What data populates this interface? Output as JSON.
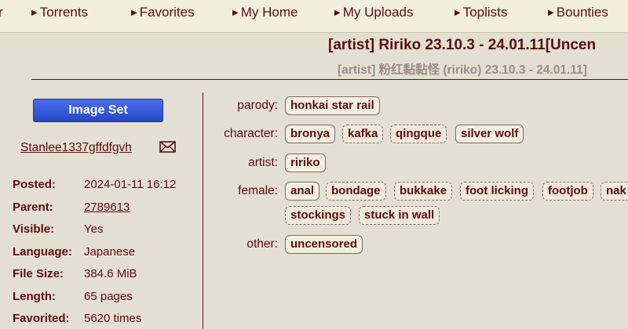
{
  "nav": {
    "edge": "r",
    "items": [
      "Torrents",
      "Favorites",
      "My Home",
      "My Uploads",
      "Toplists",
      "Bounties"
    ]
  },
  "gallery": {
    "title_en": "[artist] Ririko 23.10.3 - 24.01.11[Uncen",
    "title_jp": "[artist] 粉红黏黏怪 (ririko) 23.10.3 - 24.01.11]",
    "category": "Image Set",
    "category_color": "#2f54c9",
    "uploader": "Stanlee1337gffdfgvh",
    "info": [
      {
        "label": "Posted:",
        "value": "2024-01-11 16:12"
      },
      {
        "label": "Parent:",
        "value": "2789613"
      },
      {
        "label": "Visible:",
        "value": "Yes"
      },
      {
        "label": "Language:",
        "value": "Japanese"
      },
      {
        "label": "File Size:",
        "value": "384.6 MiB"
      },
      {
        "label": "Length:",
        "value": "65 pages"
      },
      {
        "label": "Favorited:",
        "value": "5620 times"
      }
    ]
  },
  "tags": {
    "parody_label": "parody:",
    "character_label": "character:",
    "artist_label": "artist:",
    "female_label": "female:",
    "other_label": "other:",
    "parody": [
      "honkai star rail"
    ],
    "character": [
      "bronya",
      "kafka",
      "qingque",
      "silver wolf"
    ],
    "artist": [
      "ririko"
    ],
    "female": [
      "anal",
      "bondage",
      "bukkake",
      "foot licking",
      "footjob",
      "nak",
      "stockings",
      "stuck in wall"
    ],
    "other": [
      "uncensored"
    ]
  },
  "icons": {
    "mail": "envelope-icon",
    "nav_arrow": "triangle-right-icon"
  }
}
